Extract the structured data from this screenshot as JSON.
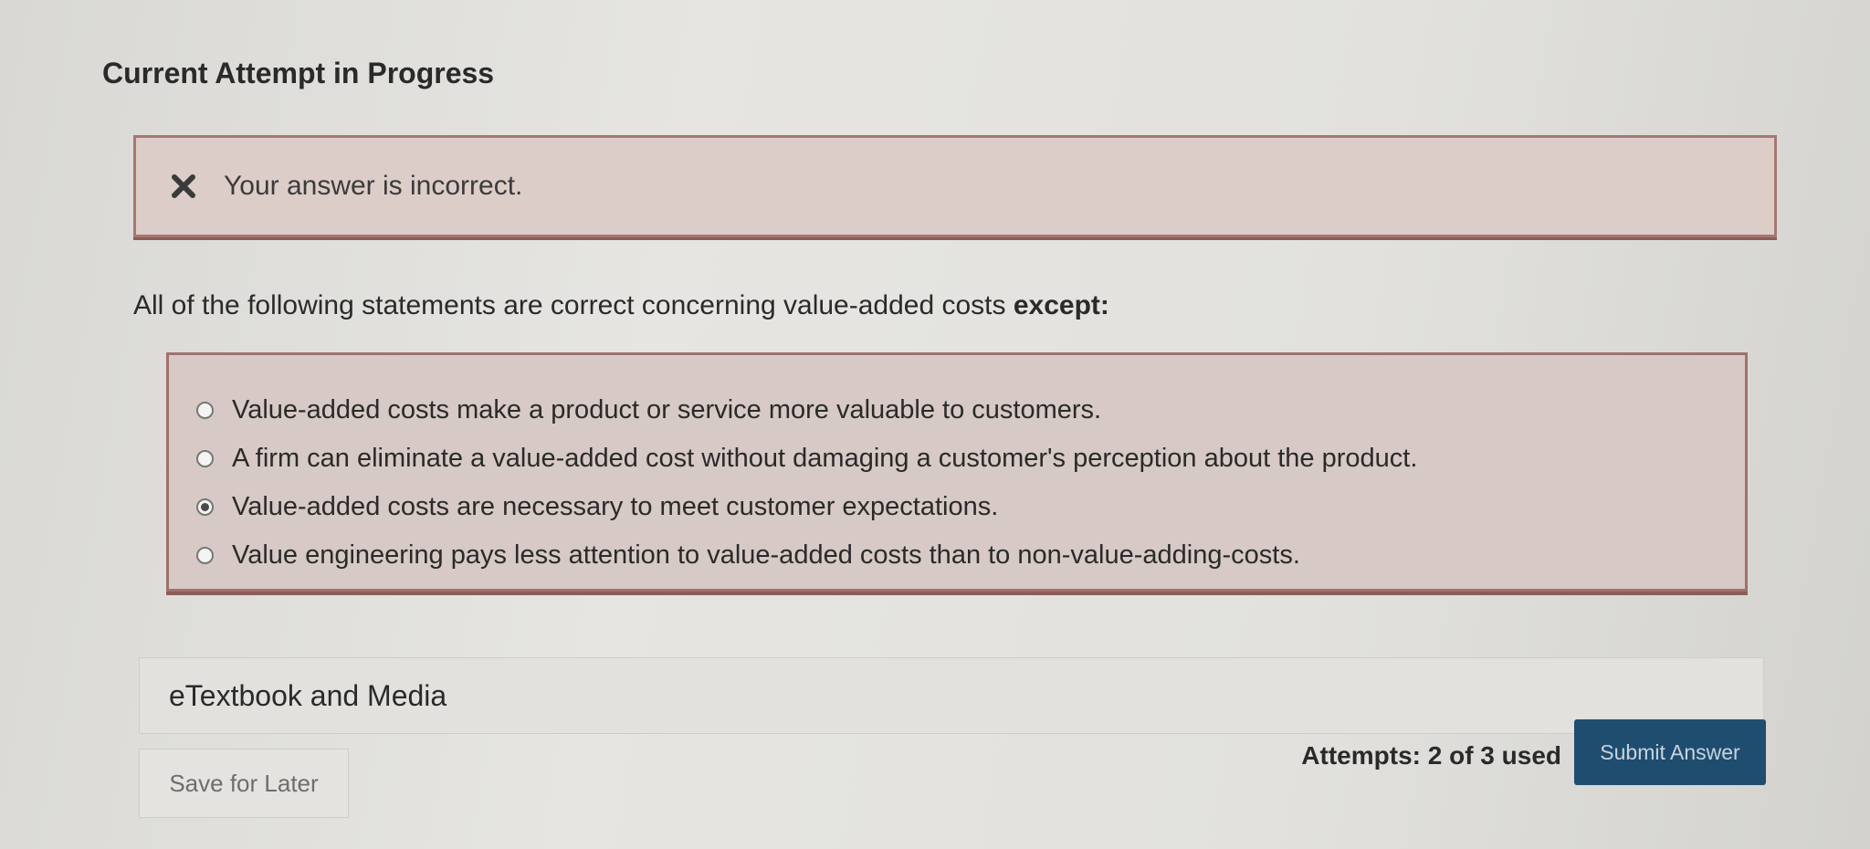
{
  "header": {
    "title": "Current Attempt in Progress"
  },
  "feedback": {
    "icon": "close-icon",
    "message": "Your answer is incorrect.",
    "color": "#a77772"
  },
  "question": {
    "text": "All of the following statements are correct concerning value-added costs ",
    "emphasis": "except:"
  },
  "options": [
    {
      "label": "Value-added costs make a product or service more valuable to customers.",
      "selected": false
    },
    {
      "label": "A firm can eliminate a value-added cost without damaging a customer's perception about the product.",
      "selected": false
    },
    {
      "label": "Value-added costs are necessary to meet customer expectations.",
      "selected": true
    },
    {
      "label": "Value engineering pays less attention to value-added costs than to non-value-adding-costs.",
      "selected": false
    }
  ],
  "resources": {
    "etextbook_label": "eTextbook and Media"
  },
  "footer": {
    "save_label": "Save for Later",
    "attempts_text": "Attempts: 2 of 3 used",
    "submit_label": "Submit Answer",
    "submit_color": "#1f4d70"
  }
}
